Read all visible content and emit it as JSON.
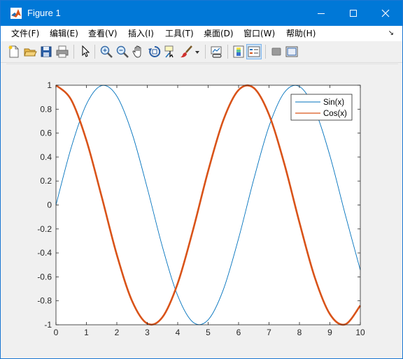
{
  "window": {
    "title": "Figure 1",
    "controls": [
      "minimize",
      "maximize",
      "close"
    ]
  },
  "menubar": {
    "items": [
      {
        "label": "文件(F)"
      },
      {
        "label": "编辑(E)"
      },
      {
        "label": "查看(V)"
      },
      {
        "label": "插入(I)"
      },
      {
        "label": "工具(T)"
      },
      {
        "label": "桌面(D)"
      },
      {
        "label": "窗口(W)"
      },
      {
        "label": "帮助(H)"
      }
    ]
  },
  "toolbar": {
    "icons": [
      "new-figure-icon",
      "open-file-icon",
      "save-icon",
      "print-icon",
      "pointer-icon",
      "zoom-in-icon",
      "zoom-out-icon",
      "pan-icon",
      "rotate-3d-icon",
      "data-cursor-icon",
      "brush-icon",
      "brush-dropdown-icon",
      "link-plot-icon",
      "insert-colorbar-icon",
      "insert-legend-icon",
      "hide-plot-tools-icon",
      "show-plot-tools-icon"
    ]
  },
  "colors": {
    "titlebar": "#0078d7",
    "sin": "#0072bd",
    "cos": "#d95319"
  },
  "chart_data": {
    "type": "line",
    "title": "",
    "xlabel": "",
    "ylabel": "",
    "xlim": [
      0,
      10
    ],
    "ylim": [
      -1,
      1
    ],
    "xticks": [
      "0",
      "1",
      "2",
      "3",
      "4",
      "5",
      "6",
      "7",
      "8",
      "9",
      "10"
    ],
    "yticks": [
      "-1",
      "-0.8",
      "-0.6",
      "-0.4",
      "-0.2",
      "0",
      "0.2",
      "0.4",
      "0.6",
      "0.8",
      "1"
    ],
    "grid": false,
    "legend_placement": "top-right",
    "series": [
      {
        "name": "Sin(x)",
        "color": "#0072bd",
        "x": [
          0,
          0.5,
          1,
          1.5,
          2,
          2.5,
          3,
          3.5,
          4,
          4.5,
          5,
          5.5,
          6,
          6.5,
          7,
          7.5,
          8,
          8.5,
          9,
          9.5,
          10
        ],
        "y": [
          0,
          0.479,
          0.841,
          0.997,
          0.909,
          0.598,
          0.141,
          -0.351,
          -0.757,
          -0.978,
          -0.959,
          -0.706,
          -0.279,
          0.215,
          0.657,
          0.938,
          0.989,
          0.798,
          0.412,
          -0.075,
          -0.544
        ]
      },
      {
        "name": "Cos(x)",
        "color": "#d95319",
        "x": [
          0,
          0.5,
          1,
          1.5,
          2,
          2.5,
          3,
          3.5,
          4,
          4.5,
          5,
          5.5,
          6,
          6.5,
          7,
          7.5,
          8,
          8.5,
          9,
          9.5,
          10
        ],
        "y": [
          1,
          0.878,
          0.54,
          0.071,
          -0.416,
          -0.801,
          -0.99,
          -0.936,
          -0.654,
          -0.211,
          0.284,
          0.709,
          0.96,
          0.977,
          0.754,
          0.347,
          -0.146,
          -0.602,
          -0.911,
          -0.997,
          -0.839
        ]
      }
    ]
  }
}
